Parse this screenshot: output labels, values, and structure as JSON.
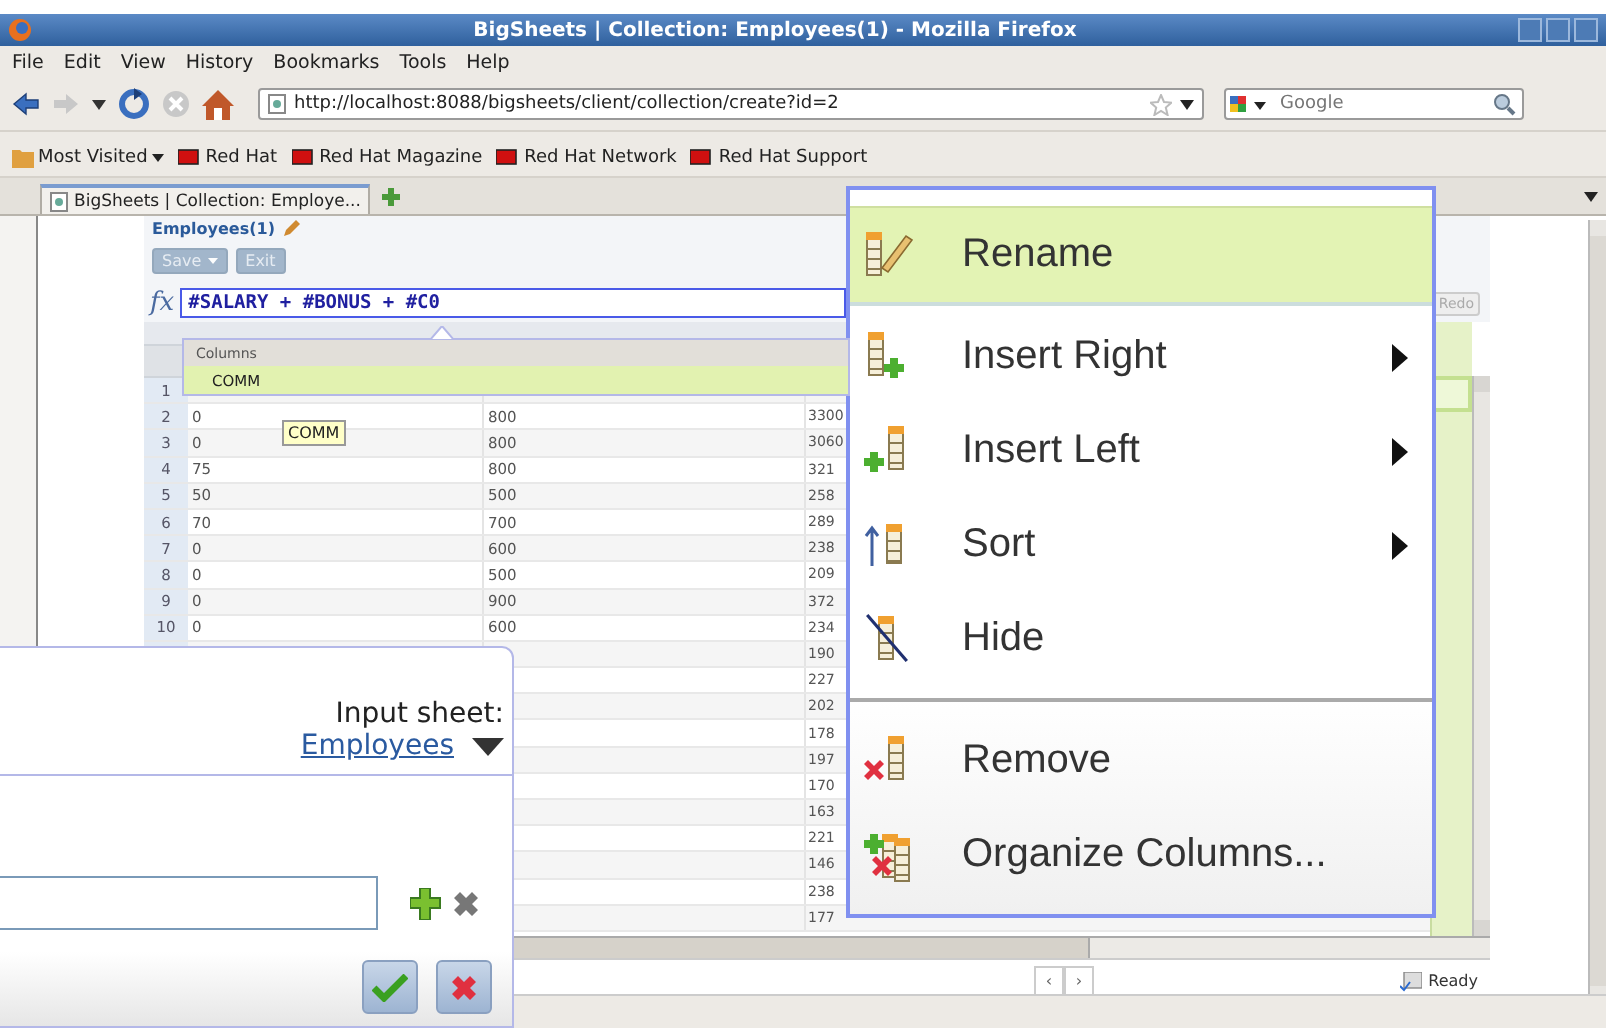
{
  "window": {
    "title": "BigSheets | Collection: Employees(1) - Mozilla Firefox"
  },
  "menu_bar": [
    "File",
    "Edit",
    "View",
    "History",
    "Bookmarks",
    "Tools",
    "Help"
  ],
  "address_bar": {
    "value": "http://localhost:8088/bigsheets/client/collection/create?id=2"
  },
  "search": {
    "placeholder": "Google"
  },
  "bookmarks": [
    {
      "label": "Most Visited",
      "kind": "folder"
    },
    {
      "label": "Red Hat",
      "kind": "link"
    },
    {
      "label": "Red Hat Magazine",
      "kind": "link"
    },
    {
      "label": "Red Hat Network",
      "kind": "link"
    },
    {
      "label": "Red Hat Support",
      "kind": "link"
    }
  ],
  "tabs": [
    {
      "label": "BigSheets | Collection: Employe...",
      "selected": true
    }
  ],
  "sheet": {
    "title": "Employees(1)",
    "buttons": [
      {
        "label": "Save",
        "kind": "dropdown",
        "disabled": true
      },
      {
        "label": "Exit",
        "kind": "plain",
        "disabled": true
      }
    ],
    "formula_label": "fx",
    "formula": "#SALARY + #BONUS + #C0",
    "redo": {
      "label": "Redo",
      "disabled": true
    },
    "column_popup": {
      "header": "Columns",
      "items": [
        {
          "label": "COMM",
          "selected": true
        }
      ]
    },
    "tooltip": "COMM",
    "rows": [
      {
        "number": "1",
        "cells": []
      },
      {
        "number": "2",
        "cells": [
          "0",
          "800",
          "3300"
        ]
      },
      {
        "number": "3",
        "cells": [
          "0",
          "800",
          "3060"
        ]
      },
      {
        "number": "4",
        "cells": [
          "75",
          "800",
          "321"
        ]
      },
      {
        "number": "5",
        "cells": [
          "50",
          "500",
          "258"
        ]
      },
      {
        "number": "6",
        "cells": [
          "70",
          "700",
          "289"
        ]
      },
      {
        "number": "7",
        "cells": [
          "0",
          "600",
          "238"
        ]
      },
      {
        "number": "8",
        "cells": [
          "0",
          "500",
          "209"
        ]
      },
      {
        "number": "9",
        "cells": [
          "0",
          "900",
          "372"
        ]
      },
      {
        "number": "10",
        "cells": [
          "0",
          "600",
          "234"
        ]
      },
      {
        "cells": [
          "",
          "",
          "190"
        ]
      },
      {
        "cells": [
          "",
          "",
          "227"
        ]
      },
      {
        "cells": [
          "",
          "",
          "202"
        ]
      },
      {
        "cells": [
          "",
          "",
          "178"
        ]
      },
      {
        "cells": [
          "",
          "",
          "197"
        ]
      },
      {
        "cells": [
          "",
          "",
          "170"
        ]
      },
      {
        "cells": [
          "",
          "",
          "163"
        ]
      },
      {
        "cells": [
          "",
          "",
          "221"
        ]
      },
      {
        "cells": [
          "",
          "",
          "146"
        ]
      },
      {
        "cells": [
          "",
          "",
          "238"
        ]
      },
      {
        "cells": [
          "",
          "",
          "177"
        ]
      }
    ],
    "pager": [
      "‹",
      "›"
    ],
    "status": "Ready"
  },
  "context_menu": {
    "groups": [
      [
        {
          "label": "Rename",
          "kind": "rename",
          "selected": true,
          "has_submenu": false
        },
        {
          "label": "Insert Right",
          "kind": "insert-right",
          "selected": false,
          "has_submenu": true
        },
        {
          "label": "Insert Left",
          "kind": "insert-left",
          "selected": false,
          "has_submenu": true
        },
        {
          "label": "Sort",
          "kind": "sort",
          "selected": false,
          "has_submenu": true
        },
        {
          "label": "Hide",
          "kind": "hide",
          "selected": false,
          "has_submenu": false
        }
      ],
      [
        {
          "label": "Remove",
          "kind": "remove",
          "selected": false,
          "has_submenu": false
        },
        {
          "label": "Organize Columns...",
          "kind": "organize",
          "selected": false,
          "has_submenu": false
        }
      ]
    ]
  },
  "dialog": {
    "input_label": "Input sheet:",
    "input_sheet": "Employees"
  }
}
